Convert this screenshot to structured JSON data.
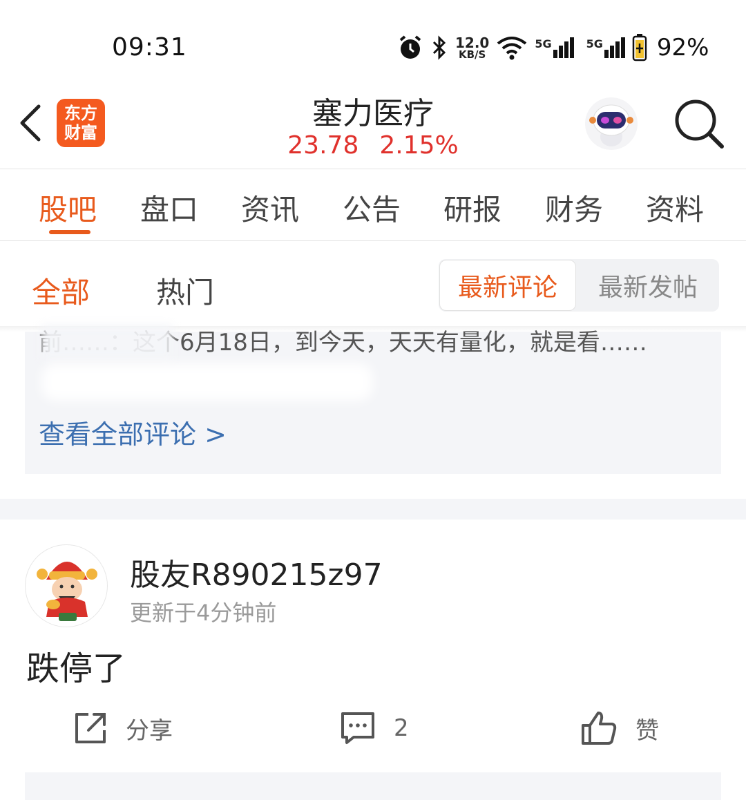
{
  "status_bar": {
    "time": "09:31",
    "net_speed_value": "12.0",
    "net_speed_unit": "KB/S",
    "signal1_label": "5G",
    "signal2_label": "5G",
    "battery": "92%"
  },
  "header": {
    "logo_line1": "东方",
    "logo_line2": "财富",
    "stock_name": "塞力医疗",
    "price": "23.78",
    "change": "2.15%"
  },
  "tabs": [
    "股吧",
    "盘口",
    "资讯",
    "公告",
    "研报",
    "财务",
    "资料"
  ],
  "filters": {
    "all": "全部",
    "hot": "热门",
    "latest_comment": "最新评论",
    "latest_post": "最新发帖"
  },
  "preview": {
    "text": "前……：这个6月18日，到今天，天天有量化，就是看……",
    "view_all": "查看全部评论 >"
  },
  "post": {
    "username": "股友R890215z97",
    "updated": "更新于4分钟前",
    "content": "跌停了",
    "share_label": "分享",
    "comment_count": "2",
    "like_label": "赞"
  },
  "colors": {
    "accent": "#e85a1c",
    "price_up": "#e0312c",
    "link": "#3c6fb0"
  }
}
